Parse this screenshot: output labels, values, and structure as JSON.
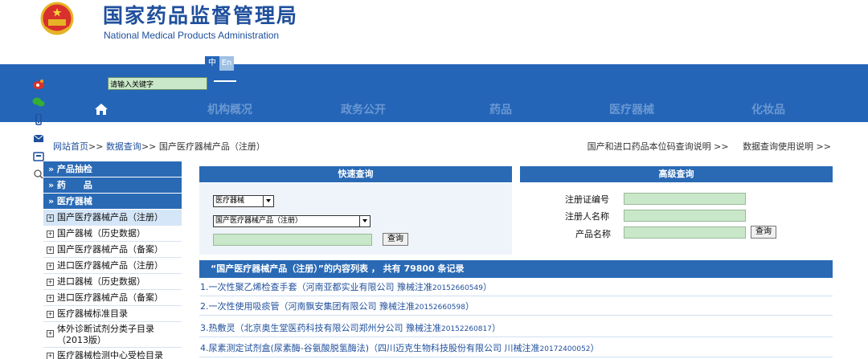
{
  "header": {
    "title_cn": "国家药品监督管理局",
    "title_en": "National Medical Products Administration"
  },
  "lang": {
    "zh": "中",
    "en": "En"
  },
  "search": {
    "placeholder": "请输入关键字"
  },
  "nav": {
    "items": [
      "机构概况",
      "政务公开",
      "药品",
      "医疗器械",
      "化妆品"
    ]
  },
  "breadcrumb": {
    "home": "网站首页",
    "sep": ">>",
    "query": "数据查询",
    "current": "国产医疗器械产品（注册）"
  },
  "help": {
    "link1": "国产和进口药品本位码查询说明 >>",
    "link2": "数据查询使用说明 >>"
  },
  "left_menu": {
    "heads": [
      "» 产品抽检",
      "» 药　　品",
      "» 医疗器械"
    ],
    "items": [
      "国产医疗器械产品（注册）",
      "国产器械（历史数据）",
      "国产医疗器械产品（备案）",
      "进口医疗器械产品（注册）",
      "进口器械（历史数据）",
      "进口医疗器械产品（备案）",
      "医疗器械标准目录",
      "体外诊断试剂分类子目录",
      "（2013版）",
      "医疗器械检测中心受检目录"
    ]
  },
  "quick": {
    "title": "快速查询",
    "select1": "医疗器械",
    "select2": "国产医疗器械产品（注册）",
    "button": "查询"
  },
  "advanced": {
    "title": "高级查询",
    "label1": "注册证编号",
    "label2": "注册人名称",
    "label3": "产品名称",
    "button": "查询"
  },
  "results": {
    "header": "“国产医疗器械产品（注册）”的内容列表 ， 共有 79800 条记录",
    "rows": [
      {
        "text": "1.一次性聚乙烯检查手套（河南亚都实业有限公司 豫械注准",
        "reg": "20152660549",
        "end": "）"
      },
      {
        "text": "2.一次性使用吸痰管（河南飘安集团有限公司 豫械注准",
        "reg": "20152660598",
        "end": "）"
      },
      {
        "text": "3.热敷灵（北京奥生堂医药科技有限公司郑州分公司 豫械注准",
        "reg": "20152260817",
        "end": "）"
      },
      {
        "text": "4.尿素测定试剂盒(尿素酶-谷氨酸脱氢酶法)（四川迈克生物科技股份有限公司 川械注准",
        "reg": "20172400052",
        "end": "）"
      }
    ]
  },
  "colors": {
    "brand_blue": "#2465b8",
    "panel_blue": "#2a6ab5",
    "field_green": "#c9e8c9",
    "link_blue": "#1f4f9c"
  },
  "icons": [
    "national-emblem-icon",
    "weibo-icon",
    "wechat-icon",
    "mobile-icon",
    "mail-icon",
    "print-icon",
    "search-icon",
    "home-icon"
  ]
}
